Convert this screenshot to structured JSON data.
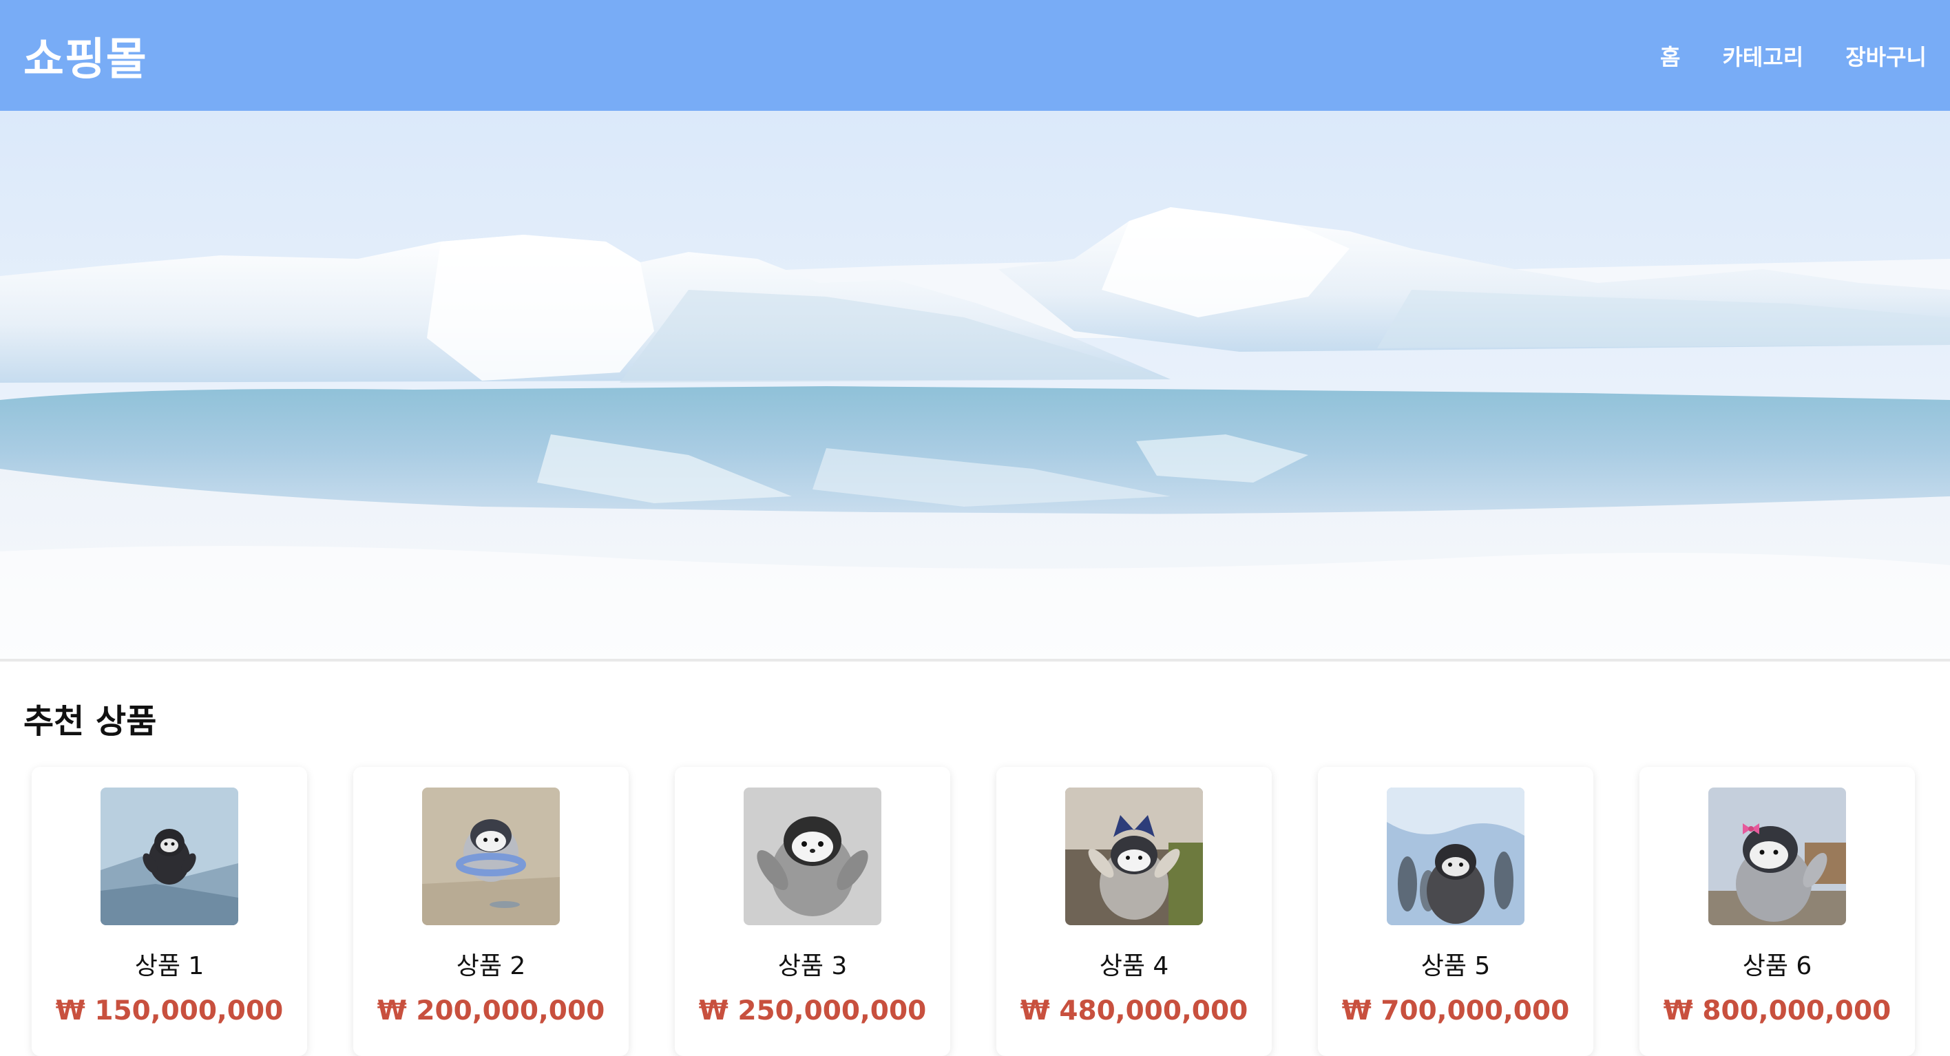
{
  "header": {
    "brand": "쇼핑몰",
    "nav": [
      {
        "label": "홈"
      },
      {
        "label": "카테고리"
      },
      {
        "label": "장바구니"
      }
    ]
  },
  "section": {
    "title": "추천 상품"
  },
  "products": [
    {
      "name": "상품 1",
      "price": "₩ 150,000,000"
    },
    {
      "name": "상품 2",
      "price": "₩ 200,000,000"
    },
    {
      "name": "상품 3",
      "price": "₩ 250,000,000"
    },
    {
      "name": "상품 4",
      "price": "₩ 480,000,000"
    },
    {
      "name": "상품 5",
      "price": "₩ 700,000,000"
    },
    {
      "name": "상품 6",
      "price": "₩ 800,000,000"
    }
  ],
  "colors": {
    "header_bg": "#78acf6",
    "price": "#c8503e"
  }
}
